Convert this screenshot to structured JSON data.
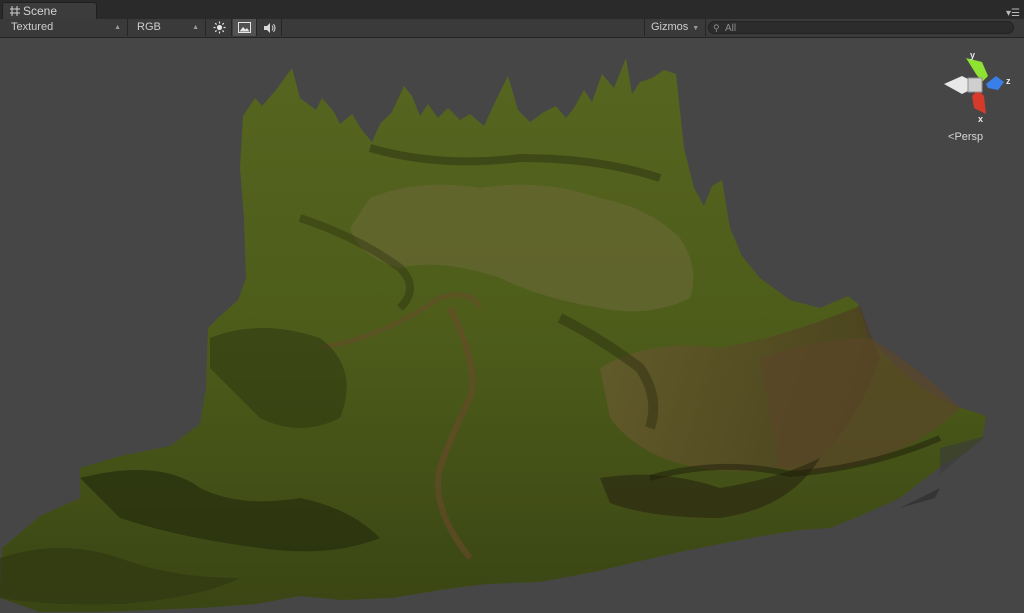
{
  "window": {
    "tab_label": "Scene",
    "menu_icon": "context-menu-icon"
  },
  "toolbar": {
    "render_mode": "Textured",
    "channel_mode": "RGB",
    "gizmos_label": "Gizmos",
    "search_placeholder": "All",
    "buttons": [
      "lighting-toggle-icon",
      "image-toggle-icon",
      "audio-toggle-icon"
    ]
  },
  "gizmo": {
    "axis_y": "y",
    "axis_z": "z",
    "axis_x": "x",
    "projection_label": "Persp",
    "colors": {
      "y": "#8ee232",
      "z": "#3a7ee8",
      "x": "#d63a2a",
      "center": "#cfcfcf"
    }
  },
  "scene": {
    "terrain_colors": [
      "#4a5a1c",
      "#5c6e24",
      "#7a6a3a",
      "#2c2e10",
      "#8a7a50"
    ]
  }
}
